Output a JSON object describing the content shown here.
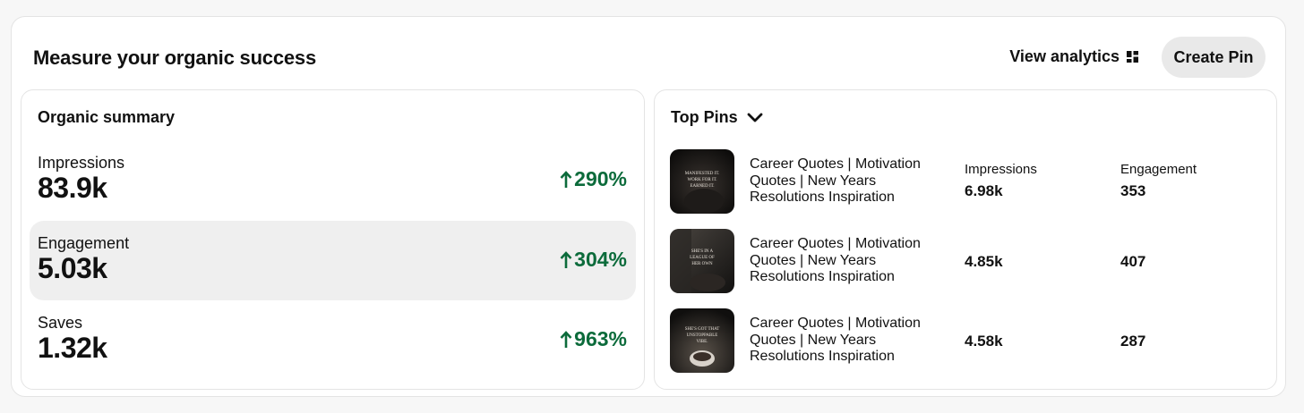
{
  "header": {
    "title": "Measure your organic success",
    "view_analytics_label": "View analytics",
    "create_pin_label": "Create Pin"
  },
  "summary": {
    "title": "Organic summary",
    "metrics": [
      {
        "label": "Impressions",
        "value": "83.9k",
        "change": "290%",
        "selected": false
      },
      {
        "label": "Engagement",
        "value": "5.03k",
        "change": "304%",
        "selected": true
      },
      {
        "label": "Saves",
        "value": "1.32k",
        "change": "963%",
        "selected": false
      }
    ]
  },
  "top_pins": {
    "title": "Top Pins",
    "columns": [
      "Impressions",
      "Engagement"
    ],
    "pins": [
      {
        "title": "Career Quotes | Motivation Quotes | New Years Resolutions Inspiration",
        "impressions": "6.98k",
        "engagement": "353",
        "thumb_text": "MANIFESTED WORK FOR IT. EARNED IT."
      },
      {
        "title": "Career Quotes | Motivation Quotes | New Years Resolutions Inspiration",
        "impressions": "4.85k",
        "engagement": "407",
        "thumb_text": "SHE'S IN A LEAGUE OF HER OWN"
      },
      {
        "title": "Career Quotes | Motivation Quotes | New Years Resolutions Inspiration",
        "impressions": "4.58k",
        "engagement": "287",
        "thumb_text": "SHE'S GOT THAT UNSTOPPABLE VIBE."
      }
    ]
  },
  "colors": {
    "positive": "#0c6b3b",
    "selected_bg": "#efefef",
    "button_bg": "#e9e9e9"
  }
}
